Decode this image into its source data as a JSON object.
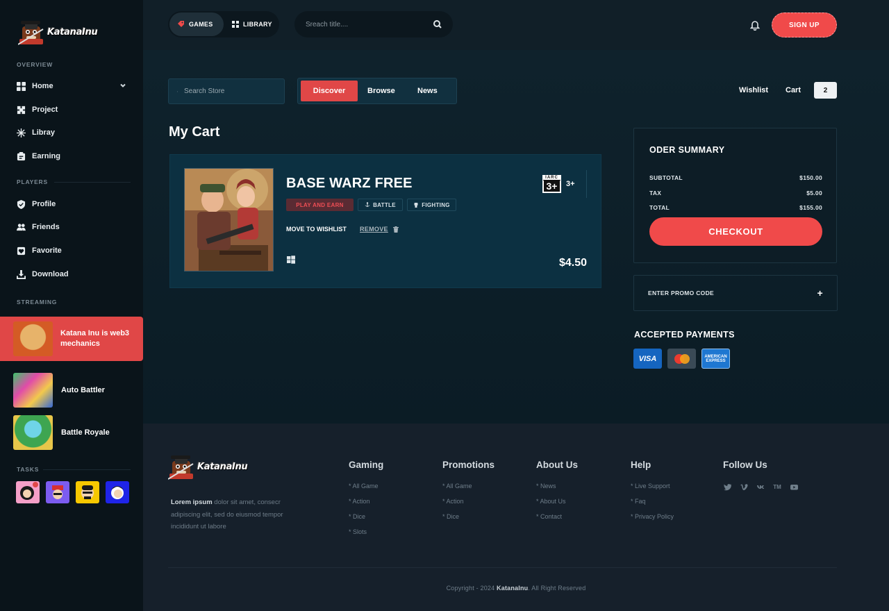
{
  "brand": {
    "name": "KatanaInu"
  },
  "sidebar": {
    "sections": {
      "overview": "OVERVIEW",
      "players": "PLAYERS",
      "streaming": "STREAMING",
      "tasks": "TASKS"
    },
    "overview_items": [
      {
        "label": "Home",
        "icon": "grid-icon"
      },
      {
        "label": "Project",
        "icon": "puzzle-icon"
      },
      {
        "label": "Libray",
        "icon": "snowflake-icon"
      },
      {
        "label": "Earning",
        "icon": "wallet-icon"
      }
    ],
    "player_items": [
      {
        "label": "Profile",
        "icon": "shield-icon"
      },
      {
        "label": "Friends",
        "icon": "users-icon"
      },
      {
        "label": "Favorite",
        "icon": "heart-box-icon"
      },
      {
        "label": "Download",
        "icon": "download-icon"
      }
    ],
    "streams": [
      {
        "title": "Katana Inu is web3 mechanics",
        "active": true
      },
      {
        "title": "Auto Battler",
        "active": false
      },
      {
        "title": "Battle Royale",
        "active": false
      }
    ]
  },
  "topbar": {
    "games_label": "GAMES",
    "library_label": "LIBRARY",
    "search_placeholder": "Sreach title....",
    "signup_label": "SIGN UP"
  },
  "store": {
    "search_placeholder": "Search Store",
    "tabs": [
      "Discover",
      "Browse",
      "News"
    ],
    "active_tab": "Discover",
    "wishlist_label": "Wishlist",
    "cart_label": "Cart",
    "cart_count": "2"
  },
  "cart": {
    "title": "My Cart",
    "item": {
      "title": "BASE WARZ FREE",
      "tags": [
        "PLAY AND EARN",
        "BATTLE",
        "FIGHTING"
      ],
      "move_to_wishlist": "MOVE TO WISHLIST",
      "remove": "REMOVE",
      "price": "$4.50",
      "rating_top": "IARC",
      "rating_value": "3+",
      "rating_label": "3+",
      "platform_icon": "windows-icon"
    }
  },
  "summary": {
    "title": "ODER SUMMARY",
    "rows": [
      {
        "label": "SUBTOTAL",
        "value": "$150.00"
      },
      {
        "label": "TAX",
        "value": "$5.00"
      },
      {
        "label": "TOTAL",
        "value": "$155.00"
      }
    ],
    "checkout_label": "CHECKOUT",
    "promo_label": "ENTER PROMO CODE",
    "promo_icon": "+",
    "payments_title": "ACCEPTED PAYMENTS",
    "payments": {
      "visa": "VISA",
      "amex_line1": "AMERICAN",
      "amex_line2": "EXPRESS"
    }
  },
  "footer": {
    "desc_bold": "Lorem ipsum",
    "desc_rest": " dolor sit amet, consecr adipiscing elit, sed do eiusmod tempor incididunt ut labore",
    "columns": [
      {
        "title": "Gaming",
        "links": [
          "* All Game",
          "* Action",
          "* Dice",
          "* Slots"
        ]
      },
      {
        "title": "Promotions",
        "links": [
          "* All Game",
          "* Action",
          "* Dice"
        ]
      },
      {
        "title": "About Us",
        "links": [
          "* News",
          "* About Us",
          "* Contact"
        ]
      },
      {
        "title": "Help",
        "links": [
          "* Live Support",
          "* Faq",
          "* Privacy Policy"
        ]
      }
    ],
    "follow_title": "Follow Us",
    "social_tm": "TM",
    "copyright_pre": "Copyright - 2024 ",
    "copyright_brand": "KatanaInu",
    "copyright_post": ". All Right Reserved"
  }
}
